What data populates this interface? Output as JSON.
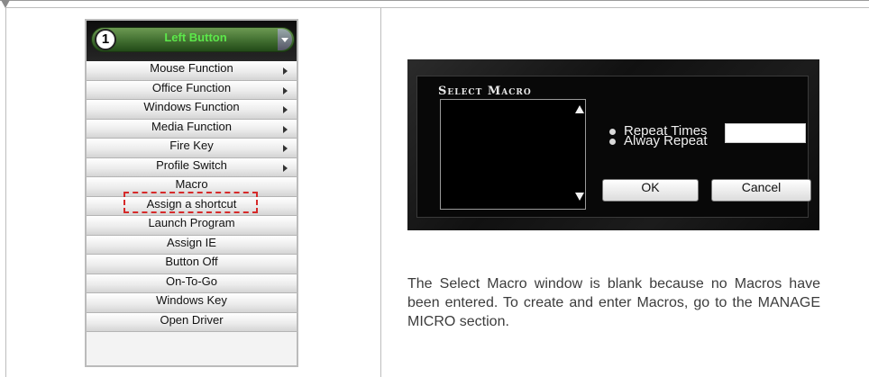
{
  "menu": {
    "header": {
      "number": "1",
      "label": "Left Button"
    },
    "items": [
      {
        "label": "Mouse Function",
        "has_submenu": true
      },
      {
        "label": "Office Function",
        "has_submenu": true
      },
      {
        "label": "Windows Function",
        "has_submenu": true
      },
      {
        "label": "Media Function",
        "has_submenu": true
      },
      {
        "label": "Fire Key",
        "has_submenu": true
      },
      {
        "label": "Profile Switch",
        "has_submenu": true
      },
      {
        "label": "Macro",
        "has_submenu": false,
        "highlighted": true
      },
      {
        "label": "Assign a shortcut",
        "has_submenu": false
      },
      {
        "label": "Launch Program",
        "has_submenu": false
      },
      {
        "label": "Assign IE",
        "has_submenu": false
      },
      {
        "label": "Button Off",
        "has_submenu": false
      },
      {
        "label": "On-To-Go",
        "has_submenu": false
      },
      {
        "label": "Windows Key",
        "has_submenu": false
      },
      {
        "label": "Open Driver",
        "has_submenu": false
      }
    ],
    "highlight_color": "#d62a2a"
  },
  "dialog": {
    "title": "Select Macro",
    "options": {
      "repeat_times": "Repeat Times",
      "always_repeat": "Alway Repeat"
    },
    "repeat_times_value": "",
    "ok_label": "OK",
    "cancel_label": "Cancel"
  },
  "caption": "The Select Macro window is blank because no Macros have been entered. To create and enter Macros, go to the MANAGE MICRO section."
}
